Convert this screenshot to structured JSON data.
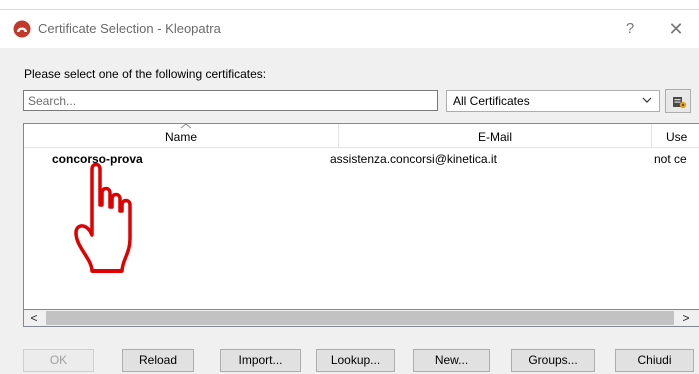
{
  "window": {
    "title": "Certificate Selection - Kleopatra",
    "help_label": "?",
    "close_label": "✕"
  },
  "prompt": "Please select one of the following certificates:",
  "search": {
    "placeholder": "Search...",
    "value": ""
  },
  "filter": {
    "selected": "All Certificates"
  },
  "table": {
    "columns": [
      "Name",
      "E-Mail",
      "Use"
    ],
    "rows": [
      {
        "name": "concorso-prova",
        "email": "assistenza.concorsi@kinetica.it",
        "use": "not ce"
      }
    ]
  },
  "scrollbar": {
    "left_arrow": "<",
    "right_arrow": ">"
  },
  "buttons": {
    "ok": "OK",
    "reload": "Reload",
    "import": "Import...",
    "lookup": "Lookup...",
    "new": "New...",
    "groups": "Groups...",
    "close": "Chiudi"
  },
  "colors": {
    "cursor": "#e00000",
    "app_icon": "#c0392b"
  },
  "icons": {
    "app": "kleopatra-icon",
    "filter_arrow": "chevron-down-icon",
    "tool": "certificate-config-icon",
    "cursor": "hand-pointer-icon"
  }
}
